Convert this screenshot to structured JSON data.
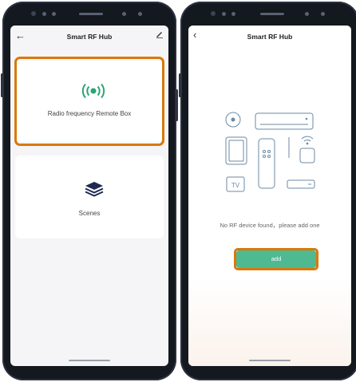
{
  "left_screen": {
    "title": "Smart RF Hub",
    "cards": [
      {
        "label": "Radio frequency Remote Box",
        "icon": "rf-signal-icon"
      },
      {
        "label": "Scenes",
        "icon": "layers-icon"
      }
    ]
  },
  "right_screen": {
    "title": "Smart RF Hub",
    "empty_message": "No RF device found，please add one",
    "add_label": "add",
    "tv_label": "TV"
  },
  "colors": {
    "highlight": "#d9780a",
    "accent_green": "#4fb991",
    "icon_dark": "#1f2a52",
    "rf_green": "#2aa573",
    "illustration": "#6b8aa3"
  }
}
